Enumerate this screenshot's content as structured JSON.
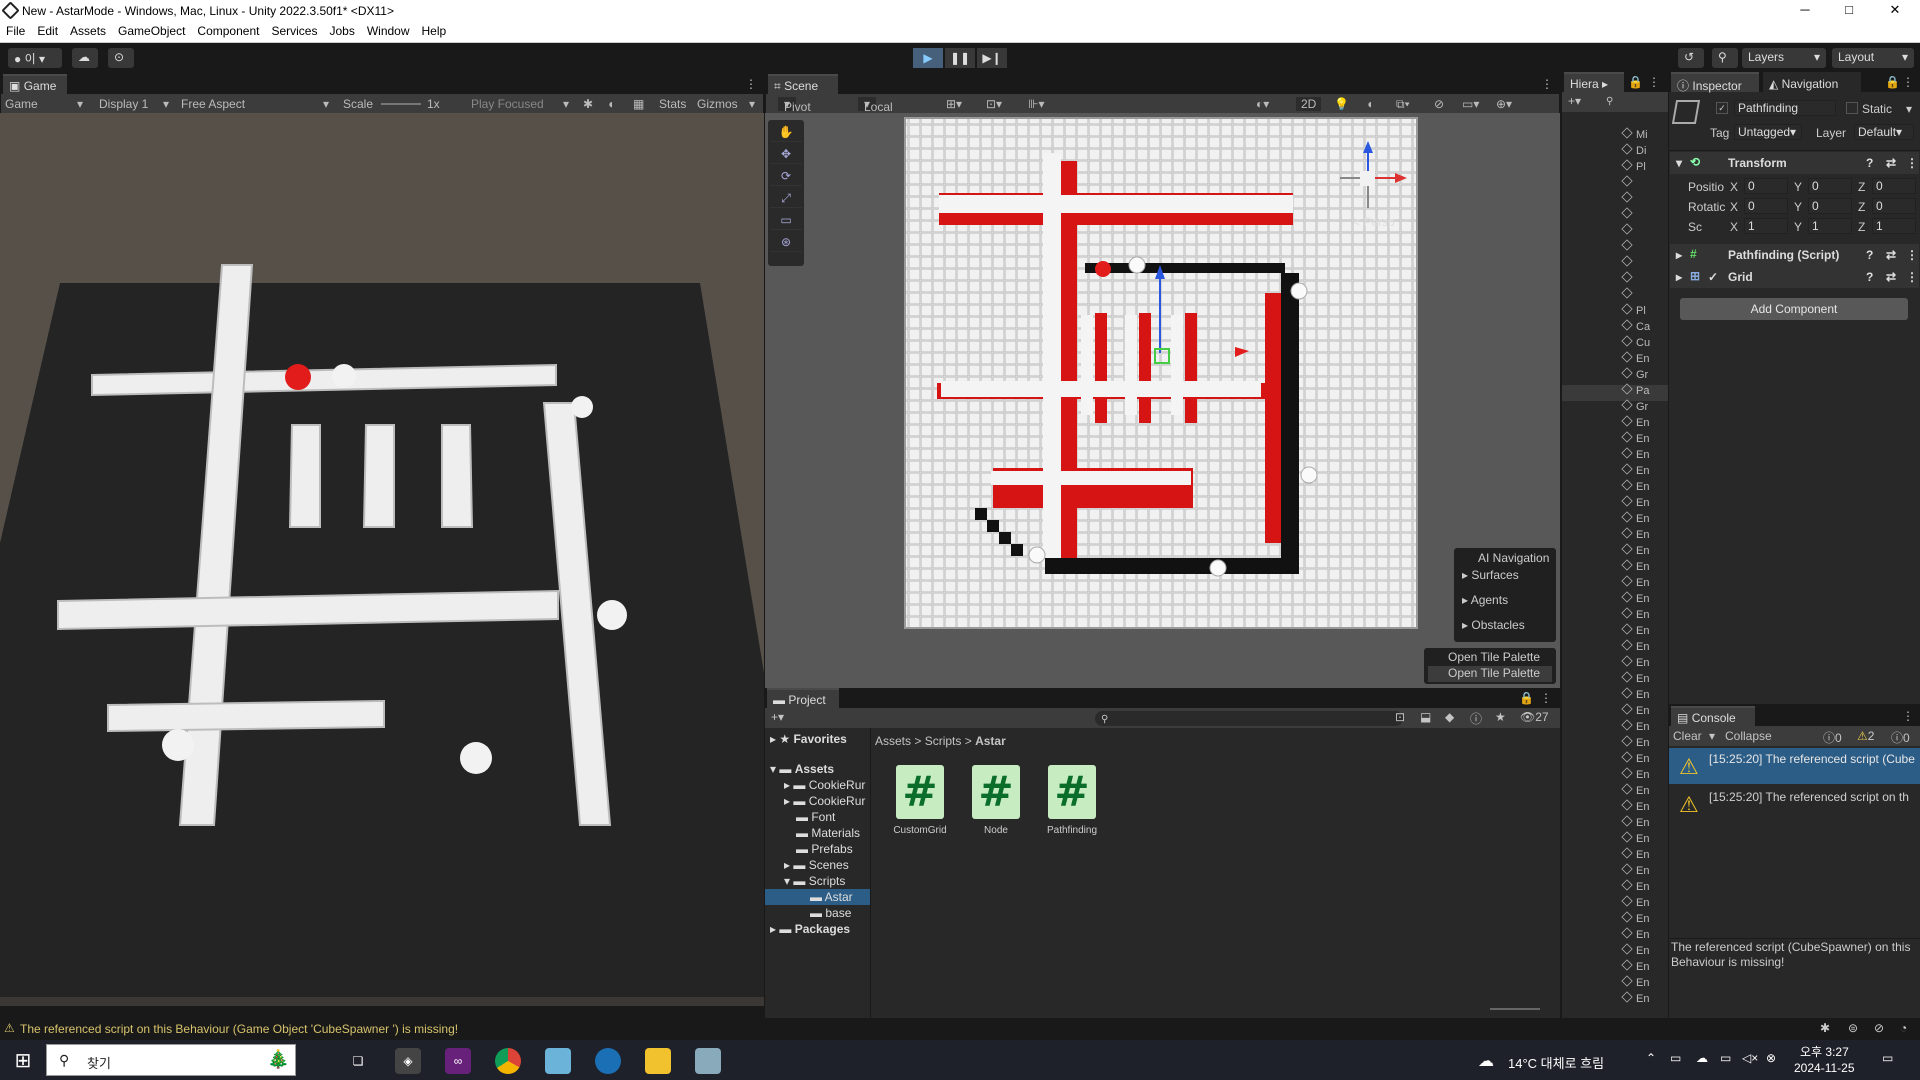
{
  "titlebar": {
    "title": "New - AstarMode - Windows, Mac, Linux - Unity 2022.3.50f1* <DX11>",
    "minimize": "─",
    "maximize": "□",
    "close": "✕"
  },
  "menu": [
    "File",
    "Edit",
    "Assets",
    "GameObject",
    "Component",
    "Services",
    "Jobs",
    "Window",
    "Help"
  ],
  "toolbar": {
    "account": "이",
    "layers": "Layers",
    "layout": "Layout"
  },
  "game": {
    "tab": "Game",
    "mode": "Game",
    "display": "Display 1",
    "aspect": "Free Aspect",
    "scale_label": "Scale",
    "scale_value": "1x",
    "play_focused": "Play Focused",
    "stats": "Stats",
    "gizmos": "Gizmos"
  },
  "scene": {
    "tab": "Scene",
    "pivot": "Pivot",
    "local": "Local",
    "mode_2d": "2D",
    "persp": "< Persp",
    "ai_nav": {
      "title": "AI Navigation",
      "items": [
        "Surfaces",
        "Agents",
        "Obstacles"
      ]
    },
    "tile_palette": {
      "title": "Open Tile Palette",
      "button": "Open Tile Palette"
    }
  },
  "project": {
    "tab": "Project",
    "count": "27",
    "favorites": "Favorites",
    "breadcrumb": [
      "Assets",
      "Scripts",
      "Astar"
    ],
    "tree": [
      "Assets",
      "CookieRur",
      "CookieRur",
      "Font",
      "Materials",
      "Prefabs",
      "Scenes",
      "Scripts",
      "Astar",
      "base",
      "Packages"
    ],
    "assets": [
      "CustomGrid",
      "Node",
      "Pathfinding"
    ]
  },
  "hierarchy": {
    "tab": "Hiera",
    "items": [
      "Mi",
      "Di",
      "Pl",
      "",
      "",
      "",
      "",
      "",
      "",
      "",
      "",
      "Pl",
      "Ca",
      "Cu",
      "En",
      "Gr",
      "Pa",
      "Gr",
      "En",
      "En",
      "En",
      "En",
      "En",
      "En",
      "En",
      "En",
      "En",
      "En",
      "En",
      "En",
      "En",
      "En",
      "En",
      "En",
      "En",
      "En",
      "En",
      "En",
      "En",
      "En",
      "En",
      "En",
      "En",
      "En",
      "En",
      "En",
      "En",
      "En",
      "En",
      "En",
      "En",
      "En",
      "En",
      "En",
      "En"
    ]
  },
  "inspector": {
    "tab": "Inspector",
    "nav_tab": "Navigation",
    "name": "Pathfinding",
    "static": "Static",
    "tag_label": "Tag",
    "tag_value": "Untagged",
    "layer_label": "Layer",
    "layer_value": "Default",
    "transform": {
      "title": "Transform",
      "rows": [
        {
          "label": "Positio",
          "x": "0",
          "y": "0",
          "z": "0"
        },
        {
          "label": "Rotatic",
          "x": "0",
          "y": "0",
          "z": "0"
        },
        {
          "label": "Sc",
          "x": "1",
          "y": "1",
          "z": "1"
        }
      ]
    },
    "script": "Pathfinding (Script)",
    "grid": "Grid",
    "add_component": "Add Component"
  },
  "console": {
    "tab": "Console",
    "clear": "Clear",
    "collapse": "Collapse",
    "errors": "0",
    "warnings": "2",
    "infos": "0",
    "messages": [
      "[15:25:20] The referenced script (Cube",
      "[15:25:20] The referenced script on th"
    ],
    "detail": "The referenced script (CubeSpawner) on this Behaviour is missing!"
  },
  "statusbar": {
    "message": "The referenced script on this Behaviour (Game Object 'CubeSpawner ') is missing!"
  },
  "taskbar": {
    "search": "찾기",
    "weather": "14°C  대체로 흐림",
    "time": "오후 3:27",
    "date": "2024-11-25"
  }
}
